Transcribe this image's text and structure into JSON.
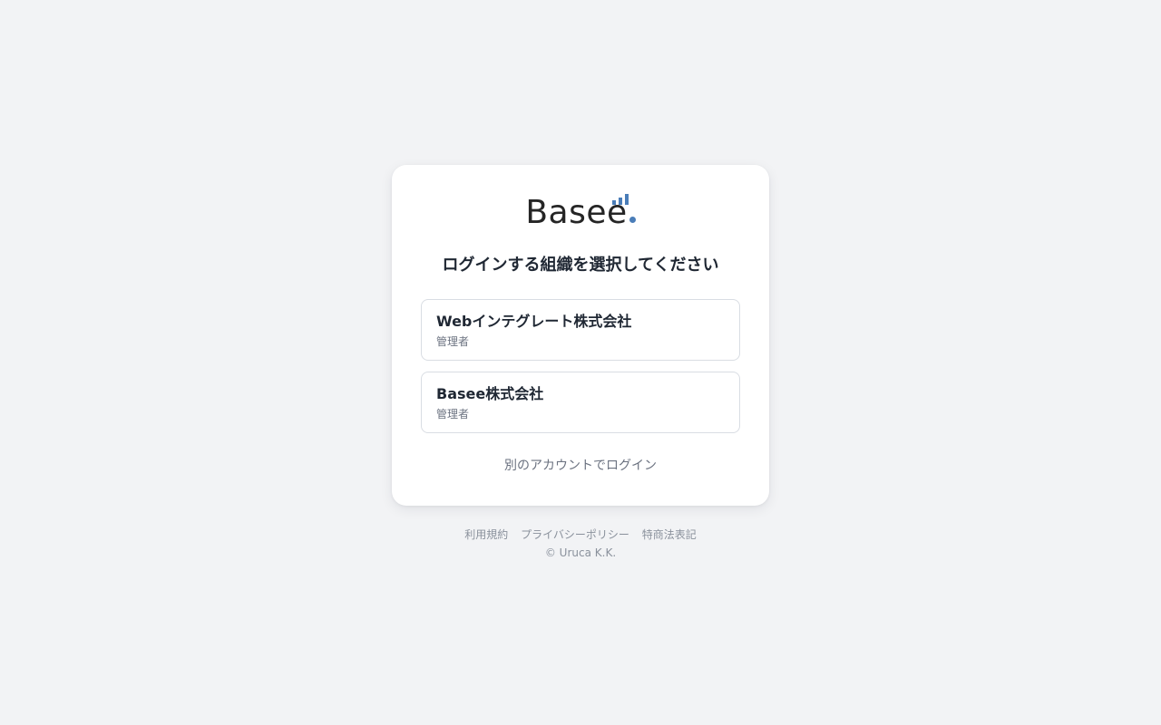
{
  "brand": {
    "logo_text": "Basee",
    "accent_color": "#4a7db8"
  },
  "heading": "ログインする組織を選択してください",
  "organizations": [
    {
      "name": "Webインテグレート株式会社",
      "role": "管理者"
    },
    {
      "name": "Basee株式会社",
      "role": "管理者"
    }
  ],
  "alt_login_label": "別のアカウントでログイン",
  "footer": {
    "links": [
      "利用規約",
      "プライバシーポリシー",
      "特商法表記"
    ],
    "copyright": "© Uruca K.K."
  }
}
